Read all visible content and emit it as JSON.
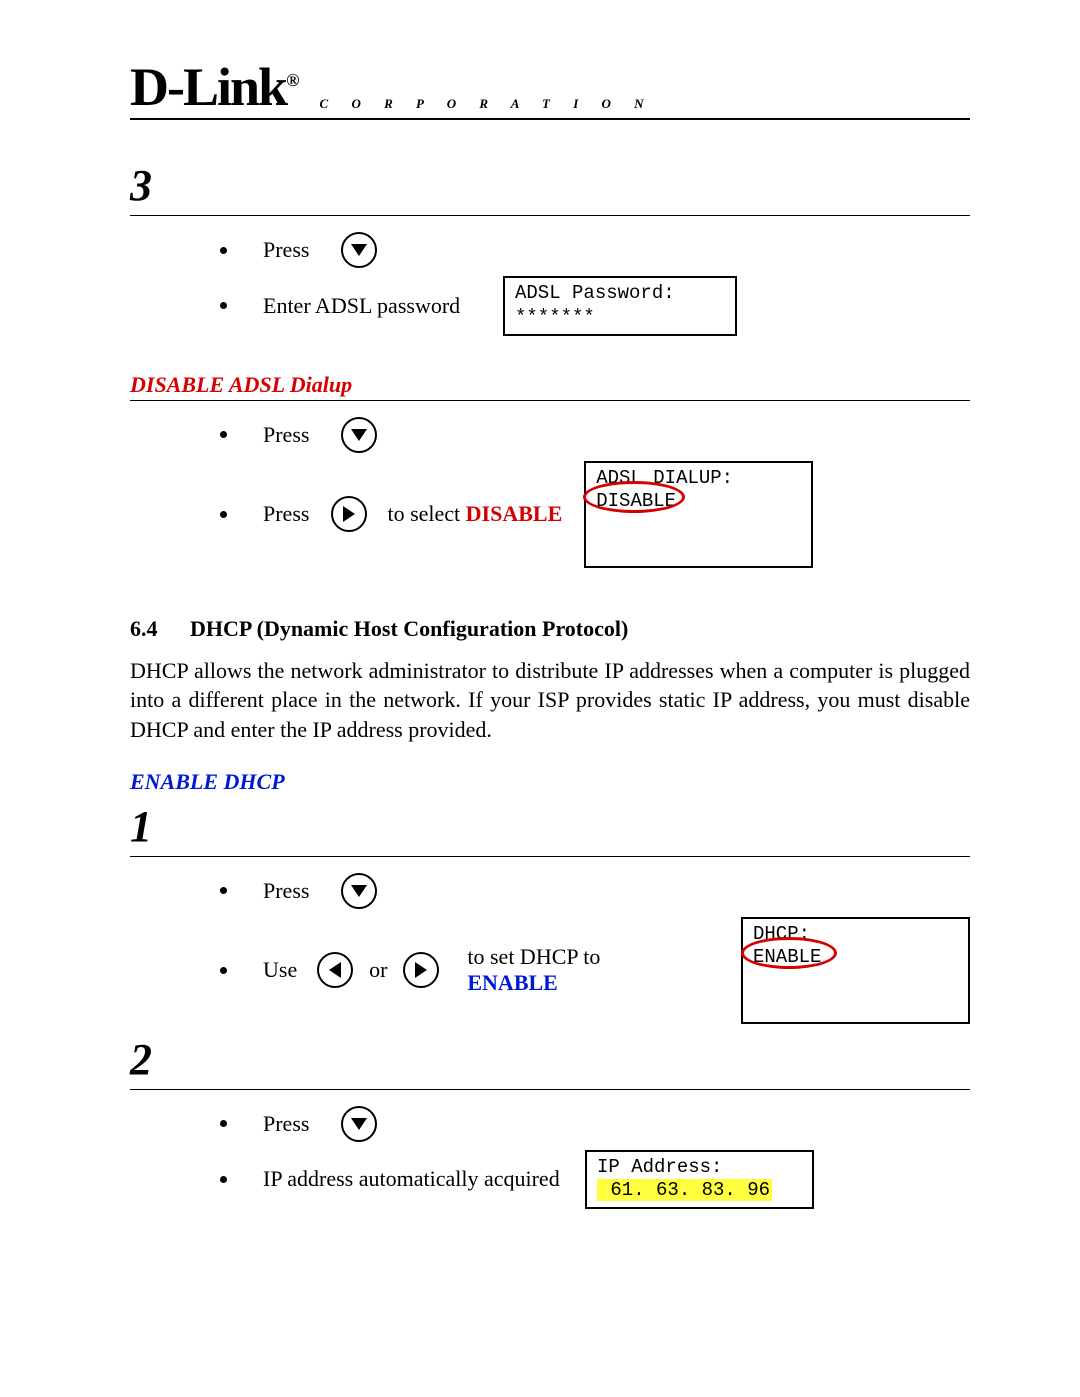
{
  "header": {
    "logo": "D-Link",
    "reg": "®",
    "corp": "C O R P O R A T I O N"
  },
  "step3": {
    "num": "3",
    "press": "Press",
    "enter_pw": "Enter ADSL password",
    "box_l1": "ADSL Password:",
    "box_l2": "*******"
  },
  "disable_adsl": {
    "title": "DISABLE ADSL Dialup",
    "press": "Press",
    "to_select": "to select ",
    "disable": "DISABLE",
    "box_l1": "ADSL DIALUP:",
    "box_l2": "DISABLE"
  },
  "section64": {
    "num": "6.4",
    "title": "DHCP (Dynamic Host Configuration Protocol)",
    "body": "DHCP allows the network administrator to distribute IP addresses when a computer is plugged into a different place in the network. If your ISP provides static IP address, you must disable DHCP and enter the IP address provided."
  },
  "enable_dhcp": {
    "title": "ENABLE DHCP",
    "step1": "1",
    "step2": "2",
    "press": "Press",
    "use": "Use",
    "or": "or",
    "to_set": "to set DHCP to ",
    "enable": "ENABLE",
    "box_dhcp_l1": "DHCP:",
    "box_dhcp_l2": "ENABLE",
    "ip_auto": "IP address automatically acquired",
    "box_ip_l1": "IP Address:",
    "box_ip_l2": " 61. 63. 83. 96"
  }
}
